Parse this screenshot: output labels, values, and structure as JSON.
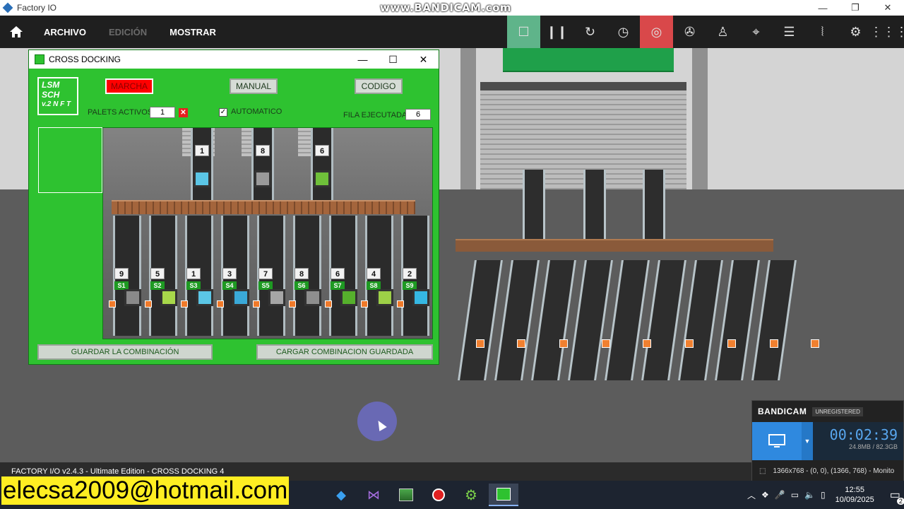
{
  "os": {
    "window_title": "Factory IO",
    "watermark": "www.BANDICAM.com"
  },
  "toolbar": {
    "menu": [
      {
        "label": "ARCHIVO",
        "enabled": true
      },
      {
        "label": "EDICIÓN",
        "enabled": false
      },
      {
        "label": "MOSTRAR",
        "enabled": true
      }
    ],
    "tools": [
      {
        "icon": "stop-square-icon",
        "state": "active-green"
      },
      {
        "icon": "pause-icon",
        "state": ""
      },
      {
        "icon": "reset-icon",
        "state": ""
      },
      {
        "icon": "timer-icon",
        "state": ""
      },
      {
        "icon": "camera-target-icon",
        "state": "active-red"
      },
      {
        "icon": "aperture-icon",
        "state": ""
      },
      {
        "icon": "person-icon",
        "state": ""
      },
      {
        "icon": "crosshair-icon",
        "state": ""
      },
      {
        "icon": "list-icon",
        "state": ""
      },
      {
        "icon": "sensor-icon",
        "state": ""
      },
      {
        "icon": "drivers-icon",
        "state": ""
      },
      {
        "icon": "grid-icon",
        "state": ""
      }
    ]
  },
  "panel": {
    "title": "CROSS DOCKING",
    "logo_line1": "LSM SCH",
    "logo_line2": "v.2 N F T",
    "buttons": {
      "marcha": "MARCHA",
      "manual": "MANUAL",
      "codigo": "CODIGO"
    },
    "palets_activos_label": "PALETS ACTIVOS",
    "palets_activos_value": "1",
    "automatico_label": "AUTOMATICO",
    "automatico_checked": "✓",
    "fila_ejecutada_label": "FILA EJECUTADA",
    "fila_ejecutada_value": "6",
    "infeed_tags": [
      "1",
      "8",
      "6"
    ],
    "infeed_colors": [
      "#5bc6e6",
      "#9a9a9a",
      "#6fc03a"
    ],
    "outfeed": [
      {
        "num": "9",
        "station": "S1",
        "color": "#8a8a8a"
      },
      {
        "num": "5",
        "station": "S2",
        "color": "#a8d84a"
      },
      {
        "num": "1",
        "station": "S3",
        "color": "#5bc6e6"
      },
      {
        "num": "3",
        "station": "S4",
        "color": "#3aa9d8"
      },
      {
        "num": "7",
        "station": "S5",
        "color": "#a6a6a6"
      },
      {
        "num": "8",
        "station": "S6",
        "color": "#8e8e8e"
      },
      {
        "num": "6",
        "station": "S7",
        "color": "#56b02c"
      },
      {
        "num": "4",
        "station": "S8",
        "color": "#9dd047"
      },
      {
        "num": "2",
        "station": "S9",
        "color": "#35b7e3"
      }
    ],
    "save_label": "GUARDAR LA COMBINACIÓN",
    "load_label": "CARGAR COMBINACION GUARDADA"
  },
  "status": {
    "text": "FACTORY I/O v2.4.3 - Ultimate Edition - CROSS DOCKING 4"
  },
  "bandicam": {
    "brand": "BANDICAM",
    "unregistered": "UNREGISTERED",
    "elapsed": "00:02:39",
    "size": "24.8MB / 82.3GB",
    "region": "1366x768 - (0, 0), (1366, 768) - Monito"
  },
  "taskbar": {
    "email": "elecsa2009@hotmail.com",
    "time": "12:55",
    "date": "10/09/2025",
    "notifications": "2"
  }
}
